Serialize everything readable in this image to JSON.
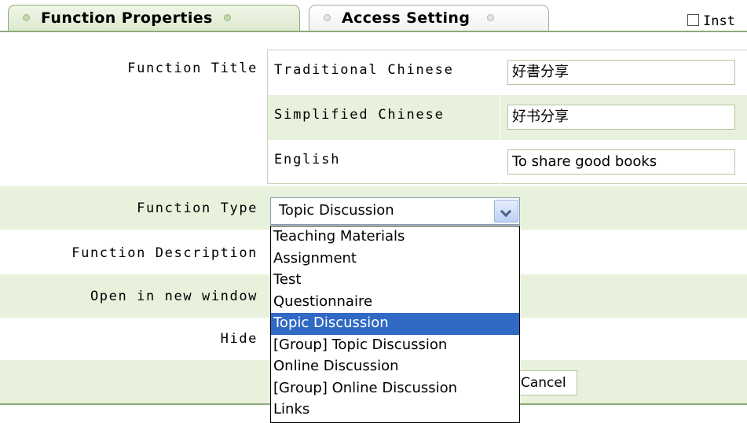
{
  "tabs": {
    "active": "Function Properties",
    "inactive": "Access Setting",
    "checkbox_label": "Inst"
  },
  "form": {
    "title_label": "Function Title",
    "languages": [
      {
        "label": "Traditional Chinese",
        "value": "好書分享"
      },
      {
        "label": "Simplified Chinese",
        "value": "好书分享"
      },
      {
        "label": "English",
        "value": "To share good books"
      }
    ],
    "type_label": "Function Type",
    "type_value": "Topic Discussion",
    "description_label": "Function Description",
    "new_window_label": "Open in new window",
    "hide_label": "Hide",
    "cancel_label": "Cancel"
  },
  "dropdown": {
    "options": [
      "Teaching Materials",
      "Assignment",
      "Test",
      "Questionnaire",
      "Topic Discussion",
      "[Group] Topic Discussion",
      "Online Discussion",
      "[Group] Online Discussion",
      "Links"
    ],
    "selected": "Topic Discussion"
  },
  "colors": {
    "row_green": "#e8f1dc",
    "border_green": "#8fa97a",
    "selection_blue": "#316ac5"
  },
  "icons": {
    "tab_bullet": "bullet-icon",
    "select_arrow": "chevron-down-icon",
    "checkbox": "checkbox-icon"
  }
}
